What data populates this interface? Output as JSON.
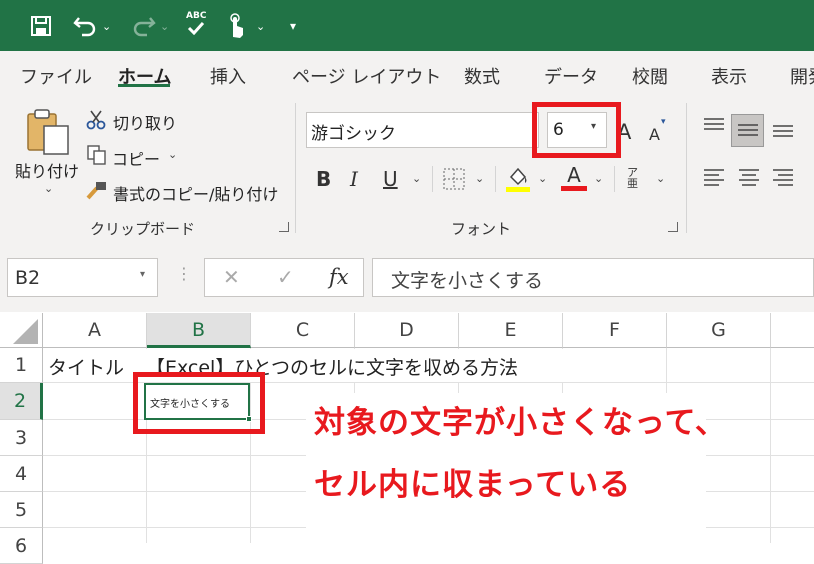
{
  "quick_access": {
    "abc_label": "ABC"
  },
  "tabs": [
    "ファイル",
    "ホーム",
    "挿入",
    "ページ レイアウト",
    "数式",
    "データ",
    "校閲",
    "表示",
    "開発"
  ],
  "clipboard": {
    "paste_label": "貼り付け",
    "cut_label": "切り取り",
    "copy_label": "コピー",
    "format_painter_label": "書式のコピー/貼り付け",
    "group_label": "クリップボード"
  },
  "font": {
    "font_name": "游ゴシック",
    "font_size": "6",
    "bold": "B",
    "italic": "I",
    "underline": "U",
    "grow_label": "A",
    "shrink_label": "A",
    "font_color_label": "A",
    "phonetic_label": "ア亜",
    "group_label": "フォント"
  },
  "formula_bar": {
    "name_box": "B2",
    "fx_label": "fx",
    "cancel": "✕",
    "enter": "✓",
    "formula": "文字を小さくする"
  },
  "grid": {
    "columns": [
      "A",
      "B",
      "C",
      "D",
      "E",
      "F",
      "G"
    ],
    "rows": [
      "1",
      "2",
      "3",
      "4",
      "5",
      "6"
    ],
    "a1": "タイトル",
    "b1": "【Excel】ひとつのセルに文字を収める方法",
    "b2": "文字を小さくする"
  },
  "annotation": {
    "line1": "対象の文字が小さくなって、",
    "line2": "セル内に収まっている"
  },
  "colors": {
    "excel_green": "#217346",
    "highlight_red": "#e8191e",
    "highlight_yellow": "#ffff00"
  }
}
